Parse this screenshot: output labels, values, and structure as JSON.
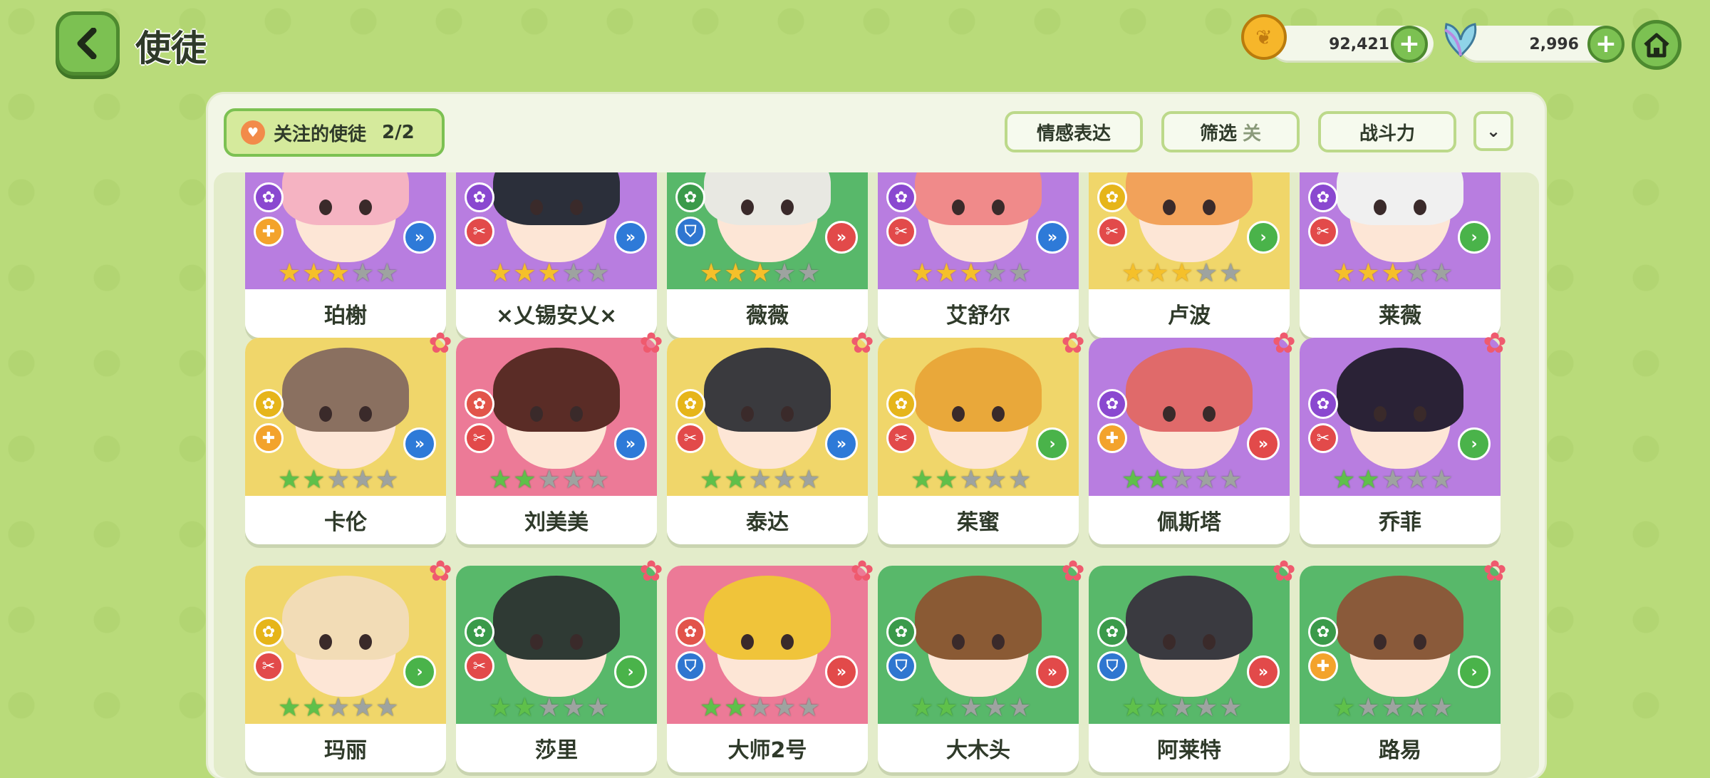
{
  "header": {
    "title": "使徒",
    "coins": "92,421",
    "gems": "2,996"
  },
  "toolbar": {
    "favorites_label": "关注的使徒",
    "favorites_count": "2/2",
    "emotion_label": "情感表达",
    "filter_label": "筛选",
    "filter_state": "关",
    "power_label": "战斗力"
  },
  "colors": {
    "purple": "#b87de0",
    "yellow": "#f0d66a",
    "green": "#58b86a",
    "pink": "#ec7a97"
  },
  "cards": [
    {
      "name": "珀榭",
      "bg": "purple",
      "stars": 3,
      "tier": "gold",
      "role": "support",
      "rank": "double",
      "hair": "#f5b3c2"
    },
    {
      "name": "×乂锡安乂×",
      "bg": "purple",
      "stars": 3,
      "tier": "gold",
      "role": "attack",
      "rank": "double",
      "hair": "#2b2f3a"
    },
    {
      "name": "薇薇",
      "bg": "green",
      "stars": 3,
      "tier": "gold",
      "role": "defense",
      "rank": "triple",
      "hair": "#e8e8e2"
    },
    {
      "name": "艾舒尔",
      "bg": "purple",
      "stars": 3,
      "tier": "gold",
      "role": "attack",
      "rank": "double",
      "hair": "#f08a8a"
    },
    {
      "name": "卢波",
      "bg": "yellow",
      "stars": 3,
      "tier": "gold",
      "role": "attack",
      "rank": "single",
      "hair": "#f2a25a"
    },
    {
      "name": "莱薇",
      "bg": "purple",
      "stars": 3,
      "tier": "gold",
      "role": "attack",
      "rank": "single",
      "hair": "#f0f0f0"
    },
    {
      "name": "卡伦",
      "bg": "yellow",
      "stars": 2,
      "tier": "green",
      "role": "support",
      "rank": "double",
      "hair": "#8a7060"
    },
    {
      "name": "刘美美",
      "bg": "pink",
      "stars": 2,
      "tier": "green",
      "role": "attack",
      "rank": "double",
      "hair": "#5a2c26"
    },
    {
      "name": "泰达",
      "bg": "yellow",
      "stars": 2,
      "tier": "green",
      "role": "attack",
      "rank": "double",
      "hair": "#3a3a3e"
    },
    {
      "name": "茱蜜",
      "bg": "yellow",
      "stars": 2,
      "tier": "green",
      "role": "attack",
      "rank": "single",
      "hair": "#e9a83a"
    },
    {
      "name": "佩斯塔",
      "bg": "purple",
      "stars": 2,
      "tier": "green",
      "role": "support",
      "rank": "triple",
      "hair": "#e06a6a"
    },
    {
      "name": "乔菲",
      "bg": "purple",
      "stars": 2,
      "tier": "green",
      "role": "attack",
      "rank": "single",
      "hair": "#2a2236"
    },
    {
      "name": "玛丽",
      "bg": "yellow",
      "stars": 2,
      "tier": "green",
      "role": "attack",
      "rank": "single",
      "hair": "#f2dcb6"
    },
    {
      "name": "莎里",
      "bg": "green",
      "stars": 2,
      "tier": "green",
      "role": "attack",
      "rank": "single",
      "hair": "#2f3a34"
    },
    {
      "name": "大师2号",
      "bg": "pink",
      "stars": 2,
      "tier": "green",
      "role": "defense",
      "rank": "triple",
      "hair": "#f0c43a"
    },
    {
      "name": "大木头",
      "bg": "green",
      "stars": 2,
      "tier": "green",
      "role": "defense",
      "rank": "triple",
      "hair": "#8a5a34"
    },
    {
      "name": "阿莱特",
      "bg": "green",
      "stars": 2,
      "tier": "green",
      "role": "defense",
      "rank": "triple",
      "hair": "#3a3a40"
    },
    {
      "name": "路易",
      "bg": "green",
      "stars": 1,
      "tier": "green",
      "role": "support",
      "rank": "single",
      "hair": "#8a5a3a"
    }
  ]
}
